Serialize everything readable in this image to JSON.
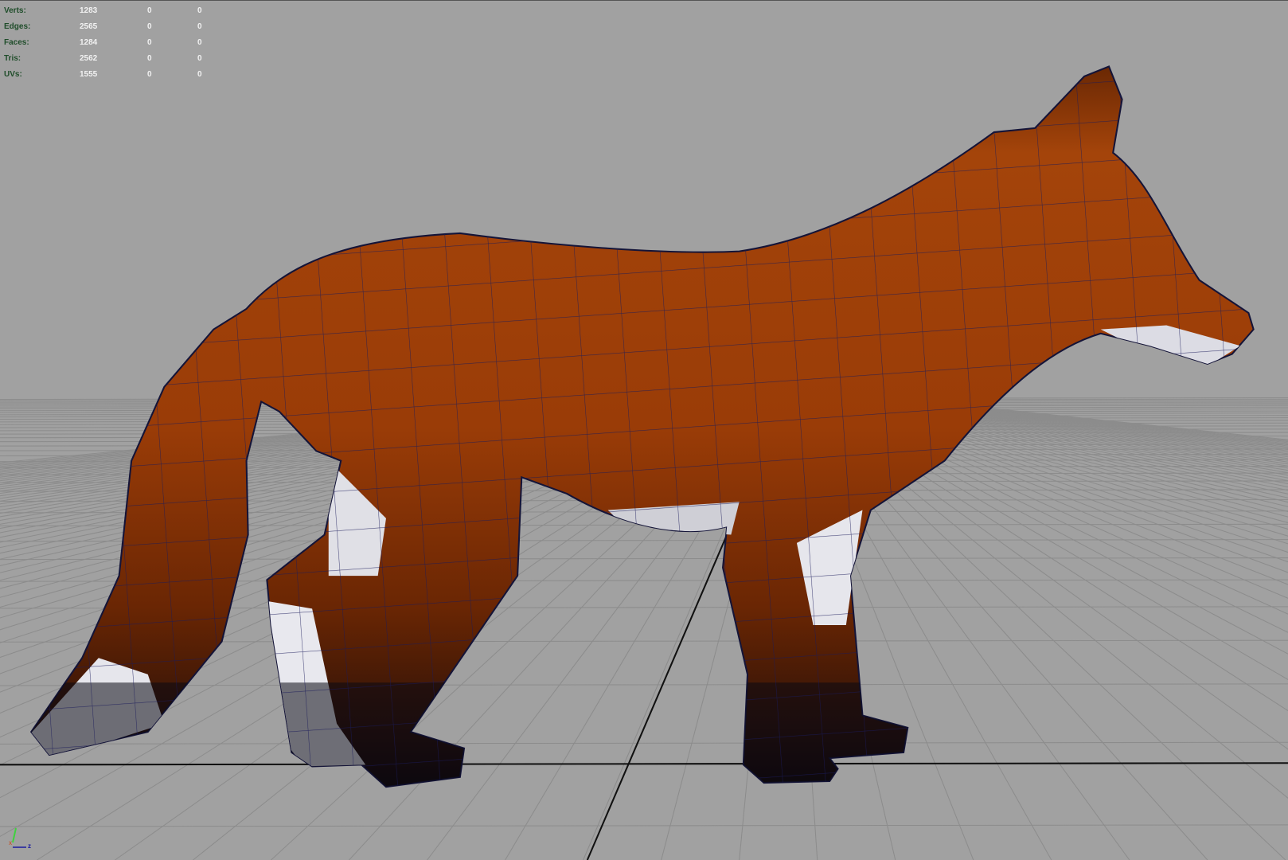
{
  "hud": {
    "rows": [
      {
        "label": "Verts:",
        "total": "1283",
        "selected": "0",
        "tri_selected": "0"
      },
      {
        "label": "Edges:",
        "total": "2565",
        "selected": "0",
        "tri_selected": "0"
      },
      {
        "label": "Faces:",
        "total": "1284",
        "selected": "0",
        "tri_selected": "0"
      },
      {
        "label": "Tris:",
        "total": "2562",
        "selected": "0",
        "tri_selected": "0"
      },
      {
        "label": "UVs:",
        "total": "1555",
        "selected": "0",
        "tri_selected": "0"
      }
    ]
  },
  "axis_indicator": {
    "x": "x",
    "z": "z"
  },
  "colors": {
    "background": "#a1a1a1",
    "grid": "#8a8a8a",
    "fur": "#9a3d08",
    "wire": "#1a1a5a",
    "hud_label": "#1f4d2a"
  }
}
